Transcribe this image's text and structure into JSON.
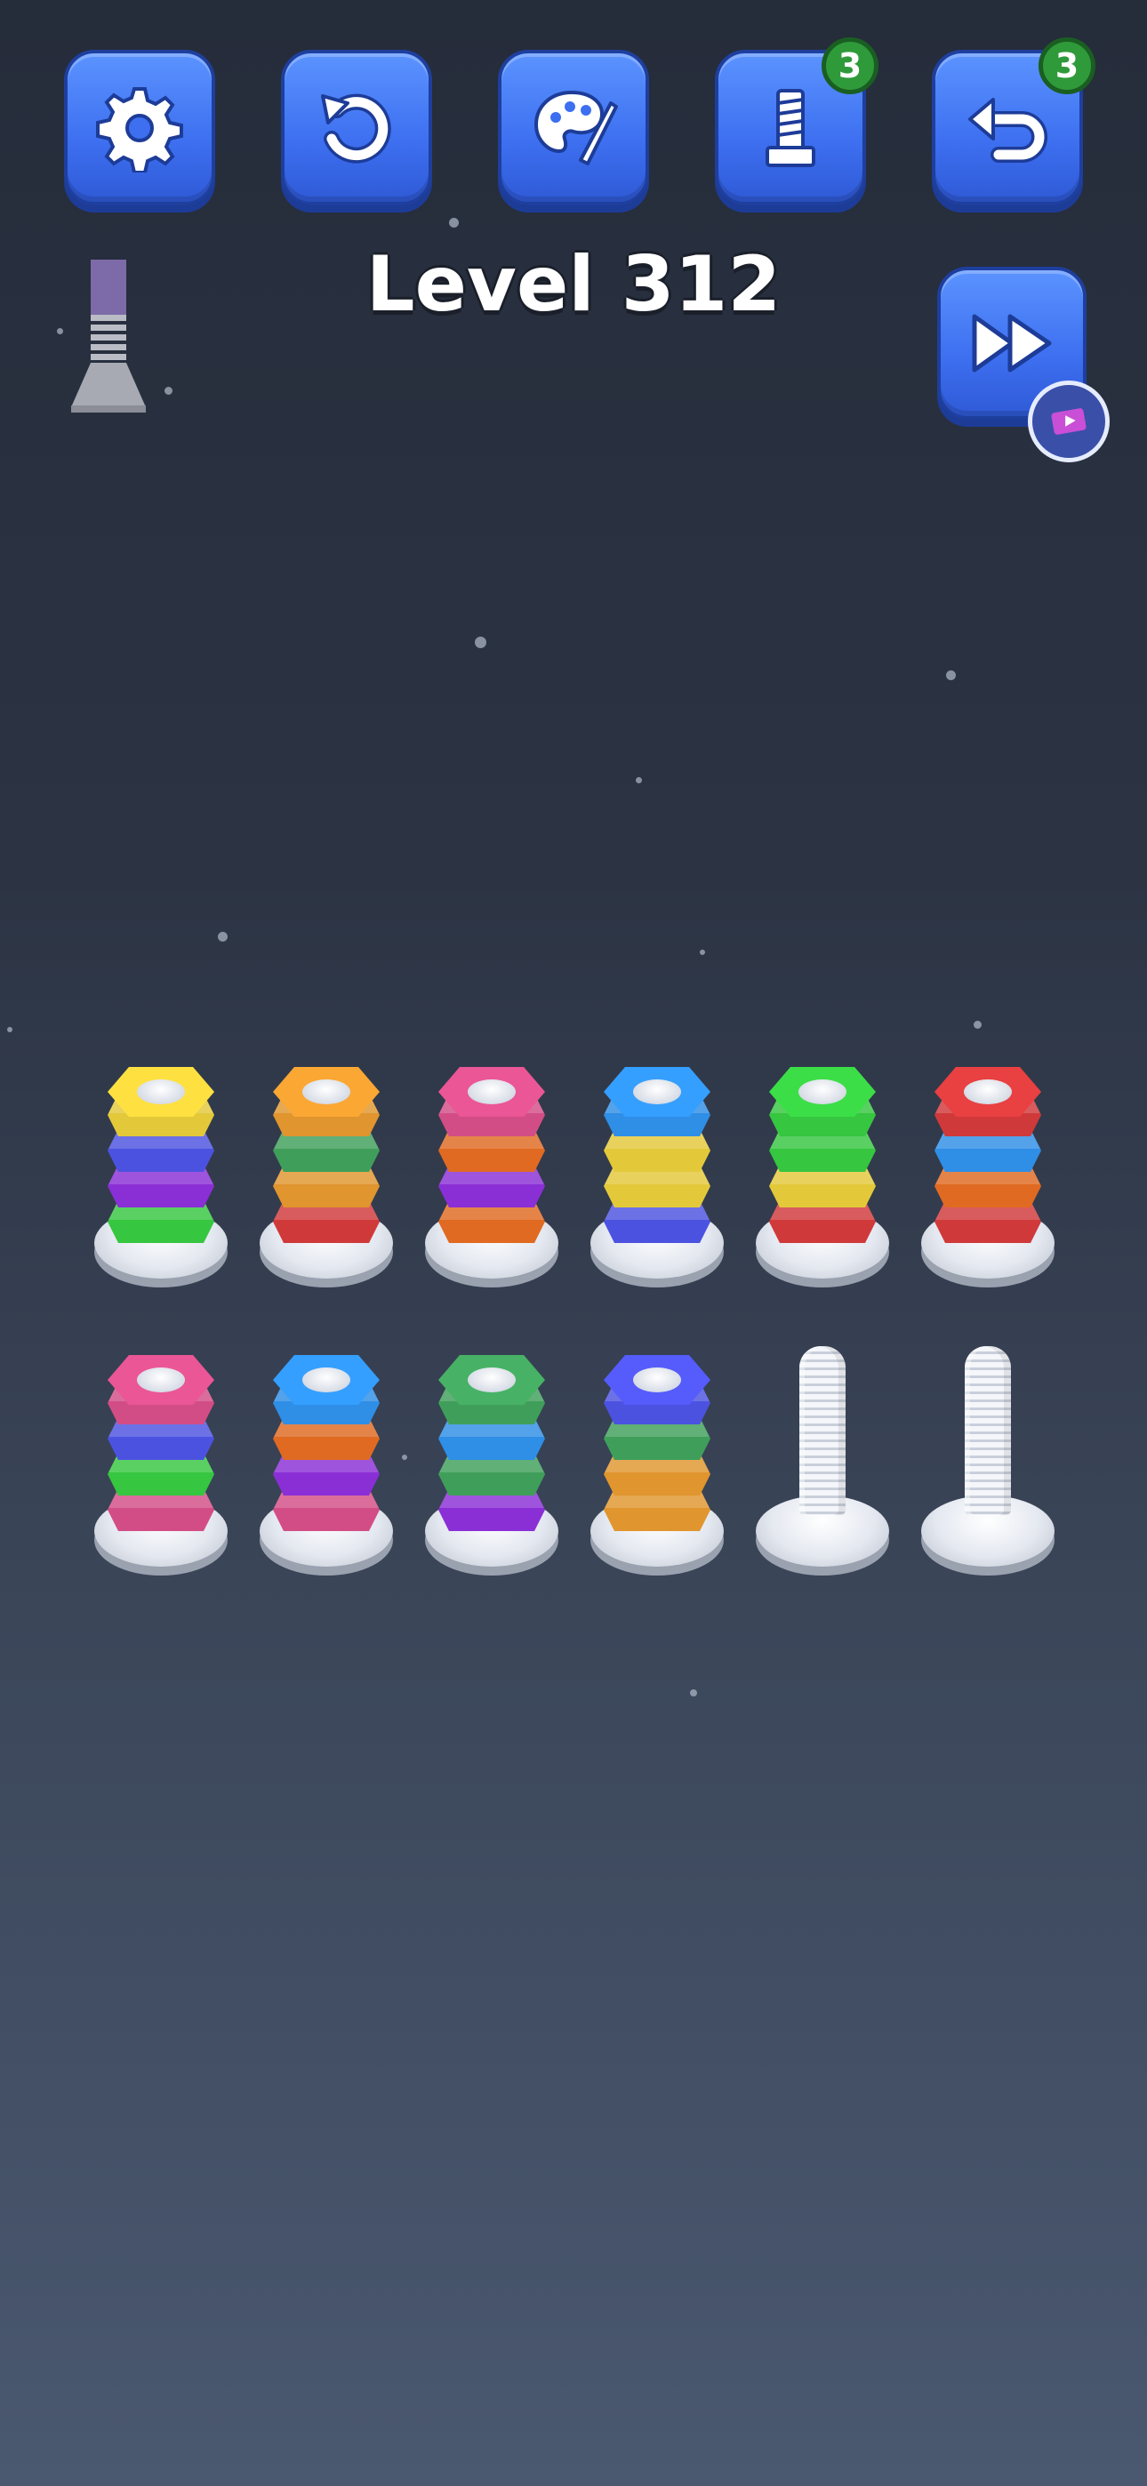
{
  "toolbar": {
    "settings": {
      "icon": "gear-icon"
    },
    "restart": {
      "icon": "restart-icon"
    },
    "theme": {
      "icon": "palette-icon"
    },
    "extra_bolt": {
      "icon": "bolt-icon",
      "count": "3"
    },
    "undo": {
      "icon": "undo-icon",
      "count": "3"
    }
  },
  "level": {
    "label": "Level 312"
  },
  "skip": {
    "icon": "fast-forward-icon",
    "ad_icon": "video-ad-icon"
  },
  "colors": {
    "yellow": "#e3c93a",
    "blue": "#4c52e0",
    "purple": "#8a2fd6",
    "green": "#36c640",
    "orange": "#e0952e",
    "darkgreen": "#3f9f5a",
    "red": "#d0393a",
    "pink": "#d24d86",
    "orangered": "#e06a22",
    "skyblue": "#2f8ee6",
    "button": "#3d6ff0",
    "badge": "#2f9a3a"
  },
  "board": {
    "rows": [
      {
        "stacks": [
          [
            "green",
            "purple",
            "blue",
            "yellow"
          ],
          [
            "red",
            "orange",
            "darkgreen",
            "orange"
          ],
          [
            "orangered",
            "purple",
            "orangered",
            "pink"
          ],
          [
            "blue",
            "yellow",
            "yellow",
            "skyblue"
          ],
          [
            "red",
            "yellow",
            "green",
            "green"
          ],
          [
            "red",
            "orangered",
            "skyblue",
            "red"
          ]
        ]
      },
      {
        "stacks": [
          [
            "pink",
            "green",
            "blue",
            "pink"
          ],
          [
            "pink",
            "purple",
            "orangered",
            "skyblue"
          ],
          [
            "purple",
            "darkgreen",
            "skyblue",
            "darkgreen"
          ],
          [
            "orange",
            "orange",
            "darkgreen",
            "blue"
          ],
          [],
          []
        ]
      }
    ]
  }
}
